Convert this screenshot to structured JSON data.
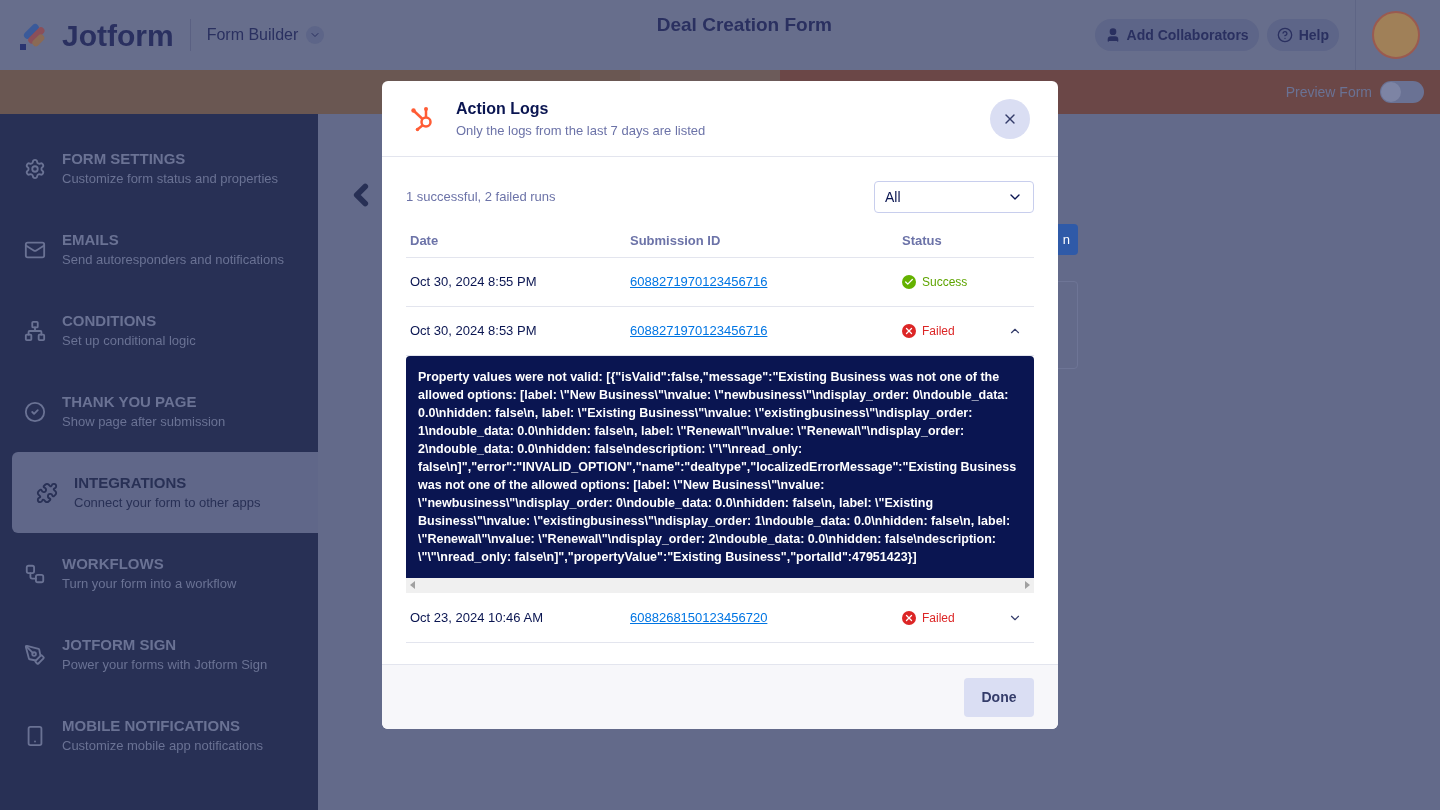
{
  "header": {
    "logo": "Jotform",
    "product": "Form Builder",
    "title": "Deal Creation Form",
    "buttons": [
      {
        "kind": "collaborators",
        "label": "Add Collaborators"
      },
      {
        "kind": "help",
        "label": "Help"
      }
    ]
  },
  "toolbar": {
    "preview": {
      "label": "Preview Form",
      "on": false
    }
  },
  "sidebar": {
    "items": [
      {
        "title": "FORM SETTINGS",
        "subtitle": "Customize form status and properties",
        "selected": false
      },
      {
        "title": "EMAILS",
        "subtitle": "Send autoresponders and notifications",
        "selected": false
      },
      {
        "title": "CONDITIONS",
        "subtitle": "Set up conditional logic",
        "selected": false
      },
      {
        "title": "THANK YOU PAGE",
        "subtitle": "Show page after submission",
        "selected": false
      },
      {
        "title": "INTEGRATIONS",
        "subtitle": "Connect your form to other apps",
        "selected": true
      },
      {
        "title": "WORKFLOWS",
        "subtitle": "Turn your form into a workflow",
        "selected": false
      },
      {
        "title": "JOTFORM SIGN",
        "subtitle": "Power your forms with Jotform Sign",
        "selected": false
      },
      {
        "title": "MOBILE NOTIFICATIONS",
        "subtitle": "Customize mobile app notifications",
        "selected": false
      }
    ]
  },
  "background": {
    "button_text": "n"
  },
  "modal": {
    "title": "Action Logs",
    "subtitle": "Only the logs from the last 7 days are listed",
    "summary": "1 successful, 2 failed runs",
    "filter": {
      "value": "All"
    },
    "columns": [
      "Date",
      "Submission ID",
      "Status"
    ],
    "rows": [
      {
        "date": "Oct 30, 2024 8:55 PM",
        "submission_id": "6088271970123456716",
        "status": {
          "kind": "success",
          "label": "Success"
        }
      },
      {
        "date": "Oct 30, 2024 8:53 PM",
        "submission_id": "6088271970123456716",
        "status": {
          "kind": "failed",
          "label": "Failed"
        },
        "expanded": true,
        "log": "Property values were not valid: [{\"isValid\":false,\"message\":\"Existing Business was not one of the allowed options: [label: \\\"New Business\\\"\\nvalue: \\\"newbusiness\\\"\\ndisplay_order: 0\\ndouble_data: 0.0\\nhidden: false\\n, label: \\\"Existing Business\\\"\\nvalue: \\\"existingbusiness\\\"\\ndisplay_order: 1\\ndouble_data: 0.0\\nhidden: false\\n, label: \\\"Renewal\\\"\\nvalue: \\\"Renewal\\\"\\ndisplay_order: 2\\ndouble_data: 0.0\\nhidden: false\\ndescription: \\\"\\\"\\nread_only: false\\n]\",\"error\":\"INVALID_OPTION\",\"name\":\"dealtype\",\"localizedErrorMessage\":\"Existing Business was not one of the allowed options: [label: \\\"New Business\\\"\\nvalue: \\\"newbusiness\\\"\\ndisplay_order: 0\\ndouble_data: 0.0\\nhidden: false\\n, label: \\\"Existing Business\\\"\\nvalue: \\\"existingbusiness\\\"\\ndisplay_order: 1\\ndouble_data: 0.0\\nhidden: false\\n, label: \\\"Renewal\\\"\\nvalue: \\\"Renewal\\\"\\ndisplay_order: 2\\ndouble_data: 0.0\\nhidden: false\\ndescription: \\\"\\\"\\nread_only: false\\n]\",\"propertyValue\":\"Existing Business\",\"portalId\":47951423}]"
      },
      {
        "date": "Oct 23, 2024 10:46 AM",
        "submission_id": "6088268150123456720",
        "status": {
          "kind": "failed",
          "label": "Failed"
        },
        "expanded": false
      }
    ],
    "done": "Done"
  }
}
